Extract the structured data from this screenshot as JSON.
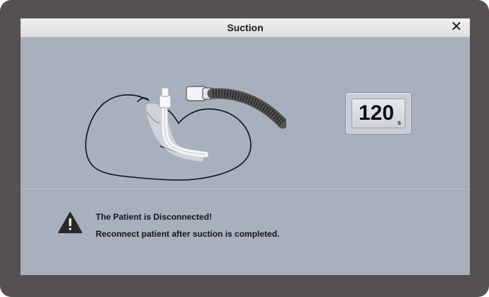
{
  "dialog": {
    "title": "Suction",
    "close_label": "✕"
  },
  "timer": {
    "value": "120",
    "unit": "s"
  },
  "warning": {
    "line1": "The Patient is Disconnected!",
    "line2": "Reconnect patient after suction is completed."
  },
  "icons": {
    "close": "close-icon",
    "warning": "warning-triangle-icon",
    "illustration": "patient-intubation-illustration"
  },
  "colors": {
    "bezel": "#555052",
    "panel": "#a8b0bd",
    "titlebar": "#e8e8e6"
  }
}
